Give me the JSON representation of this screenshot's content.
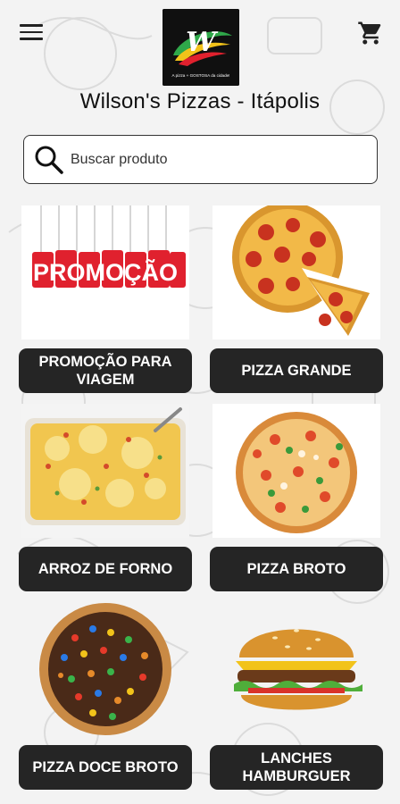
{
  "app": {
    "title": "Wilson's Pizzas - Itápolis",
    "logo": {
      "mark": "W",
      "tagline": "A pizza + GOSTOSA da cidade!"
    }
  },
  "header": {
    "menu_icon": "hamburger-menu-icon",
    "cart_icon": "shopping-cart-icon"
  },
  "search": {
    "placeholder": "Buscar produto",
    "value": "",
    "icon": "search-icon"
  },
  "categories": [
    {
      "label": "PROMOÇÃO PARA VIAGEM",
      "image": "promotion-tags",
      "promo_text": "PROMOÇÃO"
    },
    {
      "label": "PIZZA GRANDE",
      "image": "pepperoni-pizza"
    },
    {
      "label": "ARROZ DE FORNO",
      "image": "baked-rice"
    },
    {
      "label": "PIZZA BROTO",
      "image": "small-pizza"
    },
    {
      "label": "PIZZA DOCE BROTO",
      "image": "chocolate-candy-pizza"
    },
    {
      "label": "LANCHES HAMBURGUER",
      "image": "hamburger"
    }
  ],
  "colors": {
    "label_bg": "#252525",
    "label_text": "#ffffff",
    "background": "#f3f3f3",
    "promo_red": "#e0212e"
  }
}
